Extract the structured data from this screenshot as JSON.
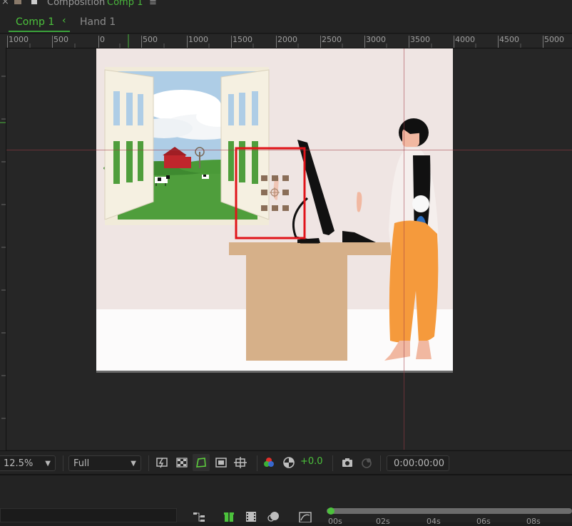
{
  "header": {
    "composition_label": "Composition",
    "composition_name": "Comp 1"
  },
  "tabs": [
    {
      "label": "Comp 1",
      "active": true
    },
    {
      "label": "Hand 1",
      "active": false
    }
  ],
  "ruler": {
    "ticks": [
      "1000",
      "500",
      "0",
      "500",
      "1000",
      "1500",
      "2000",
      "2500",
      "3000",
      "3500",
      "4000",
      "4500",
      "5000"
    ]
  },
  "toolbar": {
    "zoom": "12.5%",
    "resolution": "Full",
    "exposure": "+0.0",
    "timecode": "0:00:00:00"
  },
  "timeline": {
    "time_labels": [
      "00s",
      "02s",
      "04s",
      "06s",
      "08s"
    ]
  },
  "colors": {
    "accent_green": "#3aa33a",
    "selection_red": "#e0141a",
    "wall": "#efe5e3",
    "desk": "#d6b089",
    "pants": "#f59a3c"
  }
}
